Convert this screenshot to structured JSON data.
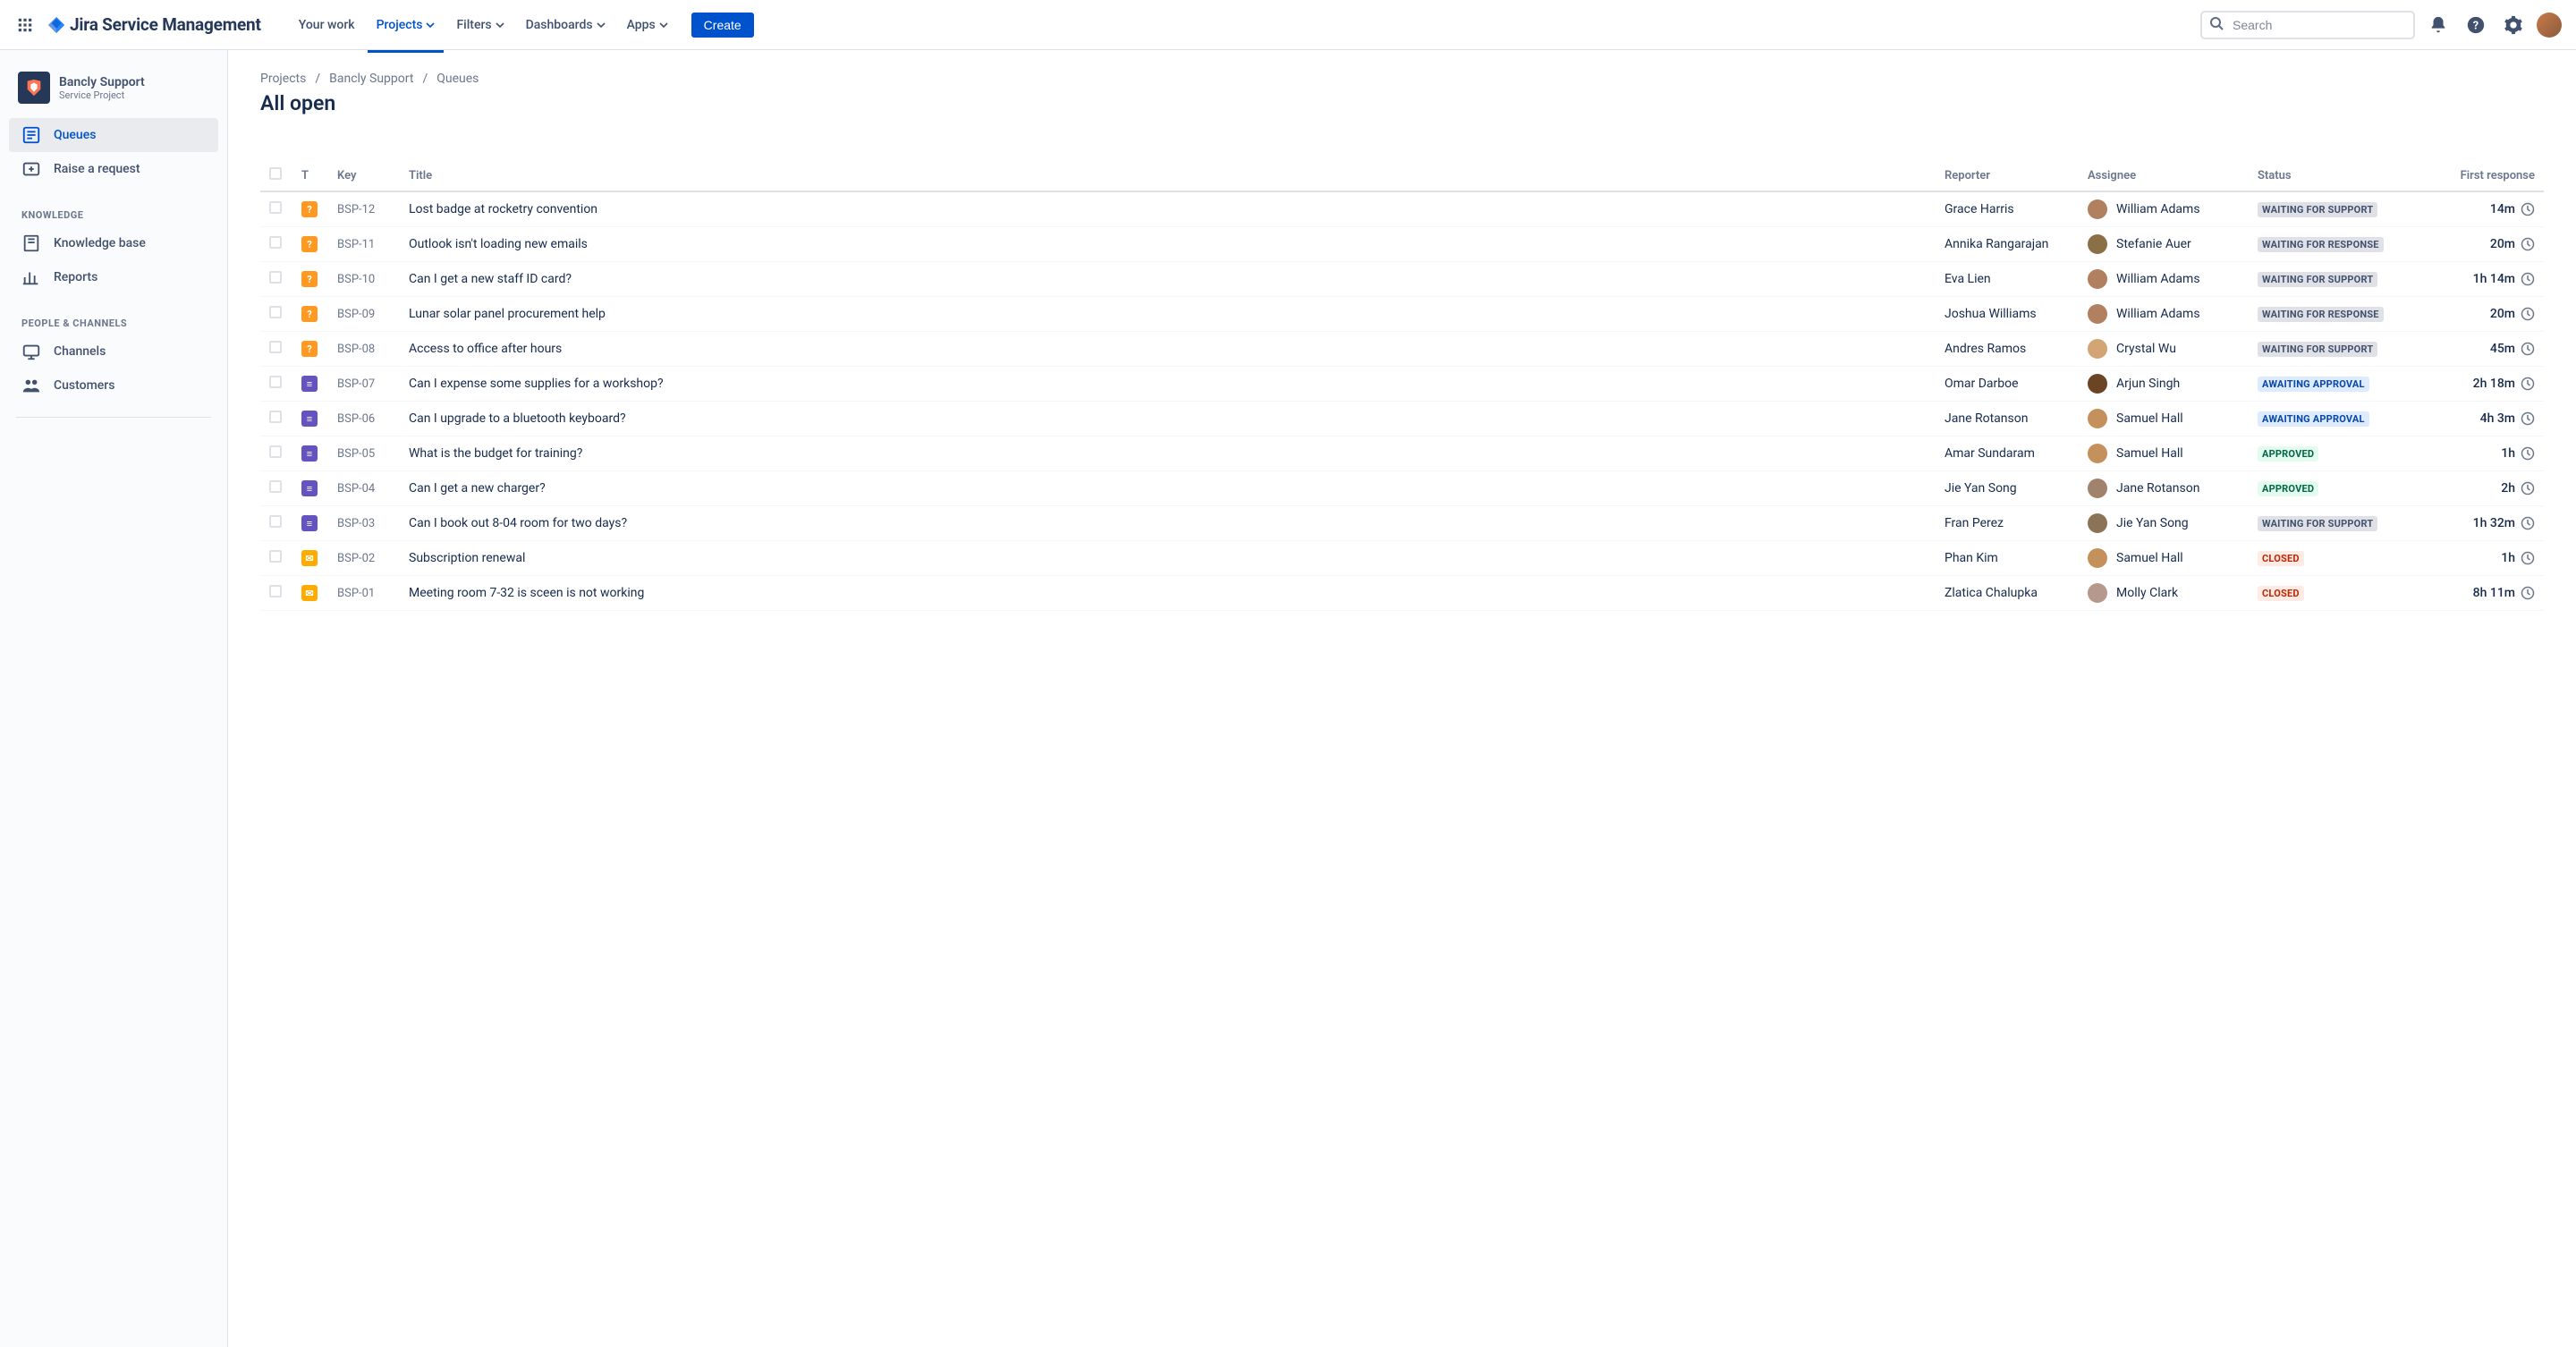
{
  "app_name": "Jira Service Management",
  "topnav": {
    "your_work": "Your work",
    "projects": "Projects",
    "filters": "Filters",
    "dashboards": "Dashboards",
    "apps": "Apps",
    "create": "Create",
    "search_placeholder": "Search"
  },
  "sidebar": {
    "project_name": "Bancly Support",
    "project_type": "Service Project",
    "queues": "Queues",
    "raise": "Raise a request",
    "knowledge_title": "KNOWLEDGE",
    "kb": "Knowledge base",
    "reports": "Reports",
    "people_title": "PEOPLE & CHANNELS",
    "channels": "Channels",
    "customers": "Customers"
  },
  "breadcrumb": {
    "projects": "Projects",
    "bancly": "Bancly Support",
    "queues": "Queues"
  },
  "page_title": "All open",
  "columns": {
    "t": "T",
    "key": "Key",
    "title": "Title",
    "reporter": "Reporter",
    "assignee": "Assignee",
    "status": "Status",
    "first_response": "First response"
  },
  "rows": [
    {
      "type": "orange",
      "glyph": "?",
      "key": "BSP-12",
      "title": "Lost badge at rocketry convention",
      "reporter": "Grace Harris",
      "assignee": "William Adams",
      "av": "#b08060",
      "status": "WAITING FOR SUPPORT",
      "st": "st-support",
      "fr": "14m"
    },
    {
      "type": "orange",
      "glyph": "?",
      "key": "BSP-11",
      "title": "Outlook isn't loading new emails",
      "reporter": "Annika Rangarajan",
      "assignee": "Stefanie Auer",
      "av": "#8b6f47",
      "status": "WAITING FOR RESPONSE",
      "st": "st-response",
      "fr": "20m"
    },
    {
      "type": "orange",
      "glyph": "?",
      "key": "BSP-10",
      "title": "Can I get a new staff ID card?",
      "reporter": "Eva Lien",
      "assignee": "William Adams",
      "av": "#b08060",
      "status": "WAITING FOR SUPPORT",
      "st": "st-support",
      "fr": "1h 14m"
    },
    {
      "type": "orange",
      "glyph": "?",
      "key": "BSP-09",
      "title": "Lunar solar panel procurement help",
      "reporter": "Joshua Williams",
      "assignee": "William Adams",
      "av": "#b08060",
      "status": "WAITING FOR RESPONSE",
      "st": "st-response",
      "fr": "20m"
    },
    {
      "type": "orange",
      "glyph": "?",
      "key": "BSP-08",
      "title": "Access to office after hours",
      "reporter": "Andres Ramos",
      "assignee": "Crystal Wu",
      "av": "#d4a574",
      "status": "WAITING FOR SUPPORT",
      "st": "st-support",
      "fr": "45m"
    },
    {
      "type": "purple",
      "glyph": "≡",
      "key": "BSP-07",
      "title": "Can I expense some supplies for a workshop?",
      "reporter": "Omar Darboe",
      "assignee": "Arjun Singh",
      "av": "#6b4423",
      "status": "AWAITING APPROVAL",
      "st": "st-approval",
      "fr": "2h 18m"
    },
    {
      "type": "purple",
      "glyph": "≡",
      "key": "BSP-06",
      "title": "Can I upgrade to a bluetooth keyboard?",
      "reporter": "Jane Rotanson",
      "assignee": "Samuel Hall",
      "av": "#c4915c",
      "status": "AWAITING APPROVAL",
      "st": "st-approval",
      "fr": "4h 3m"
    },
    {
      "type": "purple",
      "glyph": "≡",
      "key": "BSP-05",
      "title": "What is the budget for training?",
      "reporter": "Amar Sundaram",
      "assignee": "Samuel Hall",
      "av": "#c4915c",
      "status": "APPROVED",
      "st": "st-approved",
      "fr": "1h"
    },
    {
      "type": "purple",
      "glyph": "≡",
      "key": "BSP-04",
      "title": "Can I get a new charger?",
      "reporter": "Jie Yan Song",
      "assignee": "Jane Rotanson",
      "av": "#a0826d",
      "status": "APPROVED",
      "st": "st-approved",
      "fr": "2h"
    },
    {
      "type": "purple",
      "glyph": "≡",
      "key": "BSP-03",
      "title": "Can I book out 8-04 room for two days?",
      "reporter": "Fran Perez",
      "assignee": "Jie Yan Song",
      "av": "#8b7355",
      "status": "WAITING FOR SUPPORT",
      "st": "st-support",
      "fr": "1h 32m"
    },
    {
      "type": "yellow",
      "glyph": "✉",
      "key": "BSP-02",
      "title": "Subscription renewal",
      "reporter": "Phan Kim",
      "assignee": "Samuel Hall",
      "av": "#c4915c",
      "status": "CLOSED",
      "st": "st-closed",
      "fr": "1h"
    },
    {
      "type": "yellow",
      "glyph": "✉",
      "key": "BSP-01",
      "title": "Meeting room 7-32 is sceen is not working",
      "reporter": "Zlatica Chalupka",
      "assignee": "Molly Clark",
      "av": "#b5998c",
      "status": "CLOSED",
      "st": "st-closed",
      "fr": "8h 11m"
    }
  ]
}
